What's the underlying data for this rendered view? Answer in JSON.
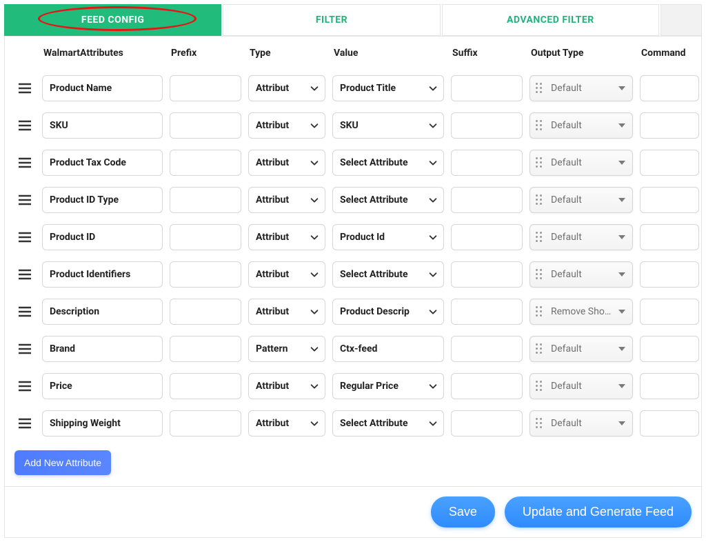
{
  "tabs": [
    {
      "label": "FEED CONFIG",
      "active": true
    },
    {
      "label": "FILTER",
      "active": false
    },
    {
      "label": "ADVANCED FILTER",
      "active": false
    }
  ],
  "columns": {
    "drag": "",
    "walmart": "WalmartAttributes",
    "prefix": "Prefix",
    "type": "Type",
    "value": "Value",
    "suffix": "Suffix",
    "output": "Output Type",
    "command": "Command",
    "del": ""
  },
  "rows": [
    {
      "walmart": "Product Name",
      "prefix": "",
      "type": "Attribute",
      "value": "Product Title",
      "suffix": "",
      "output": "Default",
      "command": ""
    },
    {
      "walmart": "SKU",
      "prefix": "",
      "type": "Attribute",
      "value": "SKU",
      "suffix": "",
      "output": "Default",
      "command": ""
    },
    {
      "walmart": "Product Tax Code",
      "prefix": "",
      "type": "Attribute",
      "value": "Select Attribute",
      "suffix": "",
      "output": "Default",
      "command": ""
    },
    {
      "walmart": "Product ID Type",
      "prefix": "",
      "type": "Attribute",
      "value": "Select Attribute",
      "suffix": "",
      "output": "Default",
      "command": ""
    },
    {
      "walmart": "Product ID",
      "prefix": "",
      "type": "Attribute",
      "value": "Product Id",
      "suffix": "",
      "output": "Default",
      "command": ""
    },
    {
      "walmart": "Product Identifiers",
      "prefix": "",
      "type": "Attribute",
      "value": "Select Attribute",
      "suffix": "",
      "output": "Default",
      "command": ""
    },
    {
      "walmart": "Description",
      "prefix": "",
      "type": "Attribute",
      "value": "Product Descrip",
      "suffix": "",
      "output": "Remove Short...",
      "command": ""
    },
    {
      "walmart": "Brand",
      "prefix": "",
      "type": "Pattern",
      "value": "Ctx-feed",
      "suffix": "",
      "output": "Default",
      "command": ""
    },
    {
      "walmart": "Price",
      "prefix": "",
      "type": "Attribute",
      "value": "Regular Price",
      "suffix": "",
      "output": "Default",
      "command": ""
    },
    {
      "walmart": "Shipping Weight",
      "prefix": "",
      "type": "Attribute",
      "value": "Select Attribute",
      "suffix": "",
      "output": "Default",
      "command": ""
    }
  ],
  "buttons": {
    "add": "Add New Attribute",
    "save": "Save",
    "update": "Update and Generate Feed"
  },
  "typeDisplay": "Attribut",
  "typeDisplayPattern": "Pattern"
}
